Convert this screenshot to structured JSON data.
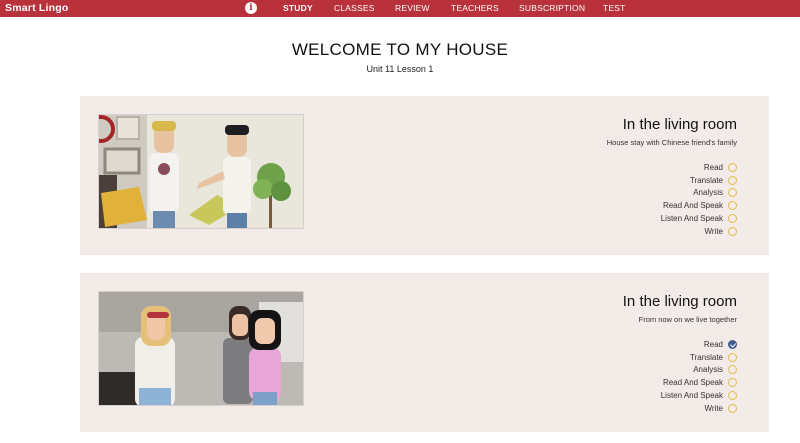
{
  "header": {
    "brand": "Smart  Lingo",
    "info_icon": "info-icon",
    "nav": [
      {
        "label": "STUDY",
        "active": true
      },
      {
        "label": "CLASSES"
      },
      {
        "label": "REVIEW"
      },
      {
        "label": "TEACHERS"
      },
      {
        "label": "SUBSCRIPTION"
      },
      {
        "label": "TEST"
      }
    ],
    "bg_color": "#b8313b"
  },
  "page": {
    "title": "WELCOME TO MY HOUSE",
    "subtitle": "Unit 11 Lesson 1"
  },
  "lessons": [
    {
      "title": "In the living room",
      "subtitle": "House stay with Chinese friend's family",
      "steps": [
        {
          "label": "Read",
          "done": false
        },
        {
          "label": "Translate",
          "done": false
        },
        {
          "label": "Analysis",
          "done": false
        },
        {
          "label": "Read And Speak",
          "done": false
        },
        {
          "label": "Listen And Speak",
          "done": false
        },
        {
          "label": "Write",
          "done": false
        }
      ]
    },
    {
      "title": "In the living room",
      "subtitle": "From now on we live together",
      "steps": [
        {
          "label": "Read",
          "done": true
        },
        {
          "label": "Translate",
          "done": false
        },
        {
          "label": "Analysis",
          "done": false
        },
        {
          "label": "Read And Speak",
          "done": false
        },
        {
          "label": "Listen And Speak",
          "done": false
        },
        {
          "label": "Write",
          "done": false
        }
      ]
    }
  ],
  "colors": {
    "card_bg": "#f3ebe8",
    "pending_circle": "#e2bf4a",
    "done_circle": "#3f5c8a"
  }
}
